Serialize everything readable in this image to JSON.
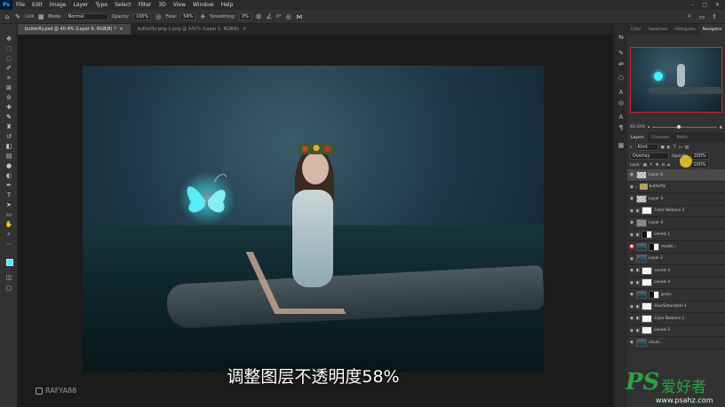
{
  "menubar": {
    "app": "Ps",
    "items": [
      "File",
      "Edit",
      "Image",
      "Layer",
      "Type",
      "Select",
      "Filter",
      "3D",
      "View",
      "Window",
      "Help"
    ]
  },
  "options": {
    "mode_label": "Mode:",
    "mode_value": "Normal",
    "opacity_label": "Opacity:",
    "opacity_value": "100%",
    "flow_label": "Flow:",
    "flow_value": "54%",
    "smoothing_label": "Smoothing:",
    "smoothing_value": "0%",
    "angle_value": "0°",
    "brush_size": "1300"
  },
  "tabs": [
    {
      "label": "butterfly.psd @ 40.4% (Layer 6, RGB/8) *"
    },
    {
      "label": "butterfly-png-1.png @ 141% (Layer 1, RGB/8)"
    }
  ],
  "subtitle": "调整图层不透明度58%",
  "watermark_handle": "RAFYA88",
  "panel_tabs": [
    "Color",
    "Swatches",
    "Histogram",
    "Navigator"
  ],
  "zoom": "40.42%",
  "layers_tabs": [
    "Layers",
    "Channels",
    "Paths"
  ],
  "layers_filter": "Kind",
  "blend_mode": "Overlay",
  "layer_opacity_label": "Opacity:",
  "layer_opacity": "100%",
  "lock_label": "Lock:",
  "fill_label": "Fill:",
  "fill_value": "100%",
  "layers": [
    {
      "name": "Layer 6",
      "thumb": "checker",
      "selected": true
    },
    {
      "name": "butterfly",
      "thumb": "folder"
    },
    {
      "name": "Layer 3",
      "thumb": "checker"
    },
    {
      "name": "Color Balance 2",
      "thumb": "white"
    },
    {
      "name": "Layer 4",
      "thumb": "gray"
    },
    {
      "name": "Levels 1",
      "thumb": "mask"
    },
    {
      "name": "model...",
      "thumb": "mask",
      "eye_red": true
    },
    {
      "name": "Layer 2",
      "thumb": "img"
    },
    {
      "name": "Levels 3",
      "thumb": "white"
    },
    {
      "name": "Levels 4",
      "thumb": "white"
    },
    {
      "name": "grass",
      "thumb": "mask"
    },
    {
      "name": "Hue/Saturation 1",
      "thumb": "white"
    },
    {
      "name": "Color Balance 1",
      "thumb": "white"
    },
    {
      "name": "Levels 2",
      "thumb": "white"
    },
    {
      "name": "cloud...",
      "thumb": "img"
    }
  ],
  "site_logo": {
    "brand": "PS",
    "cn": "爱好者",
    "url": "www.psahz.com"
  },
  "colors": {
    "accent": "#31a8ff",
    "selection_red": "#d22233",
    "butterfly_glow": "#3ff2ff"
  }
}
